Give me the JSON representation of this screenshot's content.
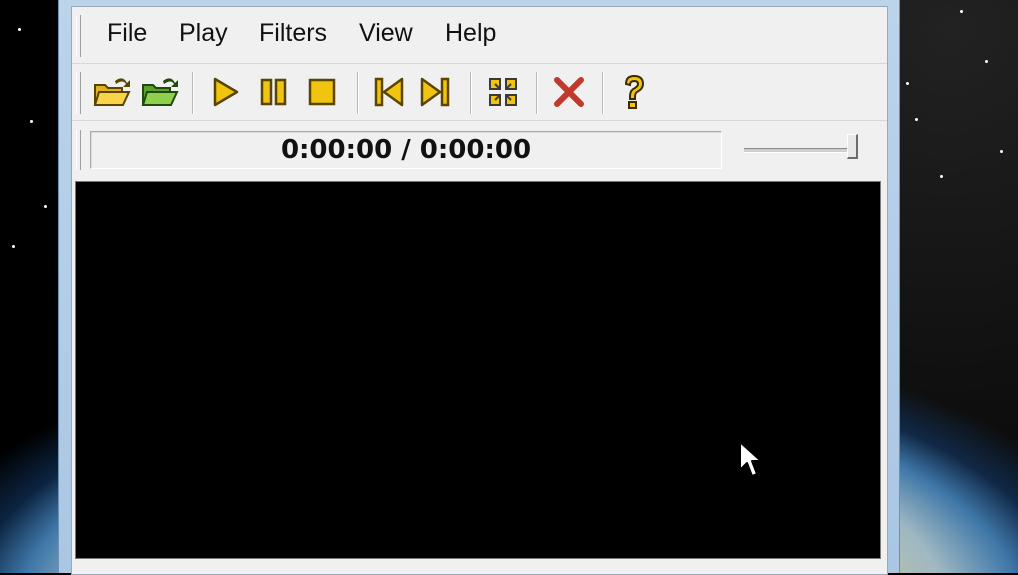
{
  "menu": {
    "items": [
      {
        "id": "file",
        "label": "File"
      },
      {
        "id": "play",
        "label": "Play"
      },
      {
        "id": "filters",
        "label": "Filters"
      },
      {
        "id": "view",
        "label": "View"
      },
      {
        "id": "help",
        "label": "Help"
      }
    ]
  },
  "toolbar": {
    "buttons": [
      {
        "name": "open-file-button",
        "icon": "folder-open-icon"
      },
      {
        "name": "open-url-button",
        "icon": "folder-open-green-icon"
      },
      {
        "name": "play-button",
        "icon": "play-icon"
      },
      {
        "name": "pause-button",
        "icon": "pause-icon"
      },
      {
        "name": "stop-button",
        "icon": "stop-icon"
      },
      {
        "name": "previous-button",
        "icon": "skip-back-icon"
      },
      {
        "name": "next-button",
        "icon": "skip-forward-icon"
      },
      {
        "name": "fullscreen-button",
        "icon": "fullscreen-icon"
      },
      {
        "name": "close-button",
        "icon": "close-x-icon"
      },
      {
        "name": "help-button",
        "icon": "question-icon"
      }
    ]
  },
  "status": {
    "time": "0:00:00 / 0:00:00"
  },
  "volume": {
    "level": 1.0
  },
  "colors": {
    "icon_yellow": "#f1c40f",
    "icon_outline": "#5a4500",
    "close_red": "#c0392b",
    "video_bg": "#000000"
  }
}
